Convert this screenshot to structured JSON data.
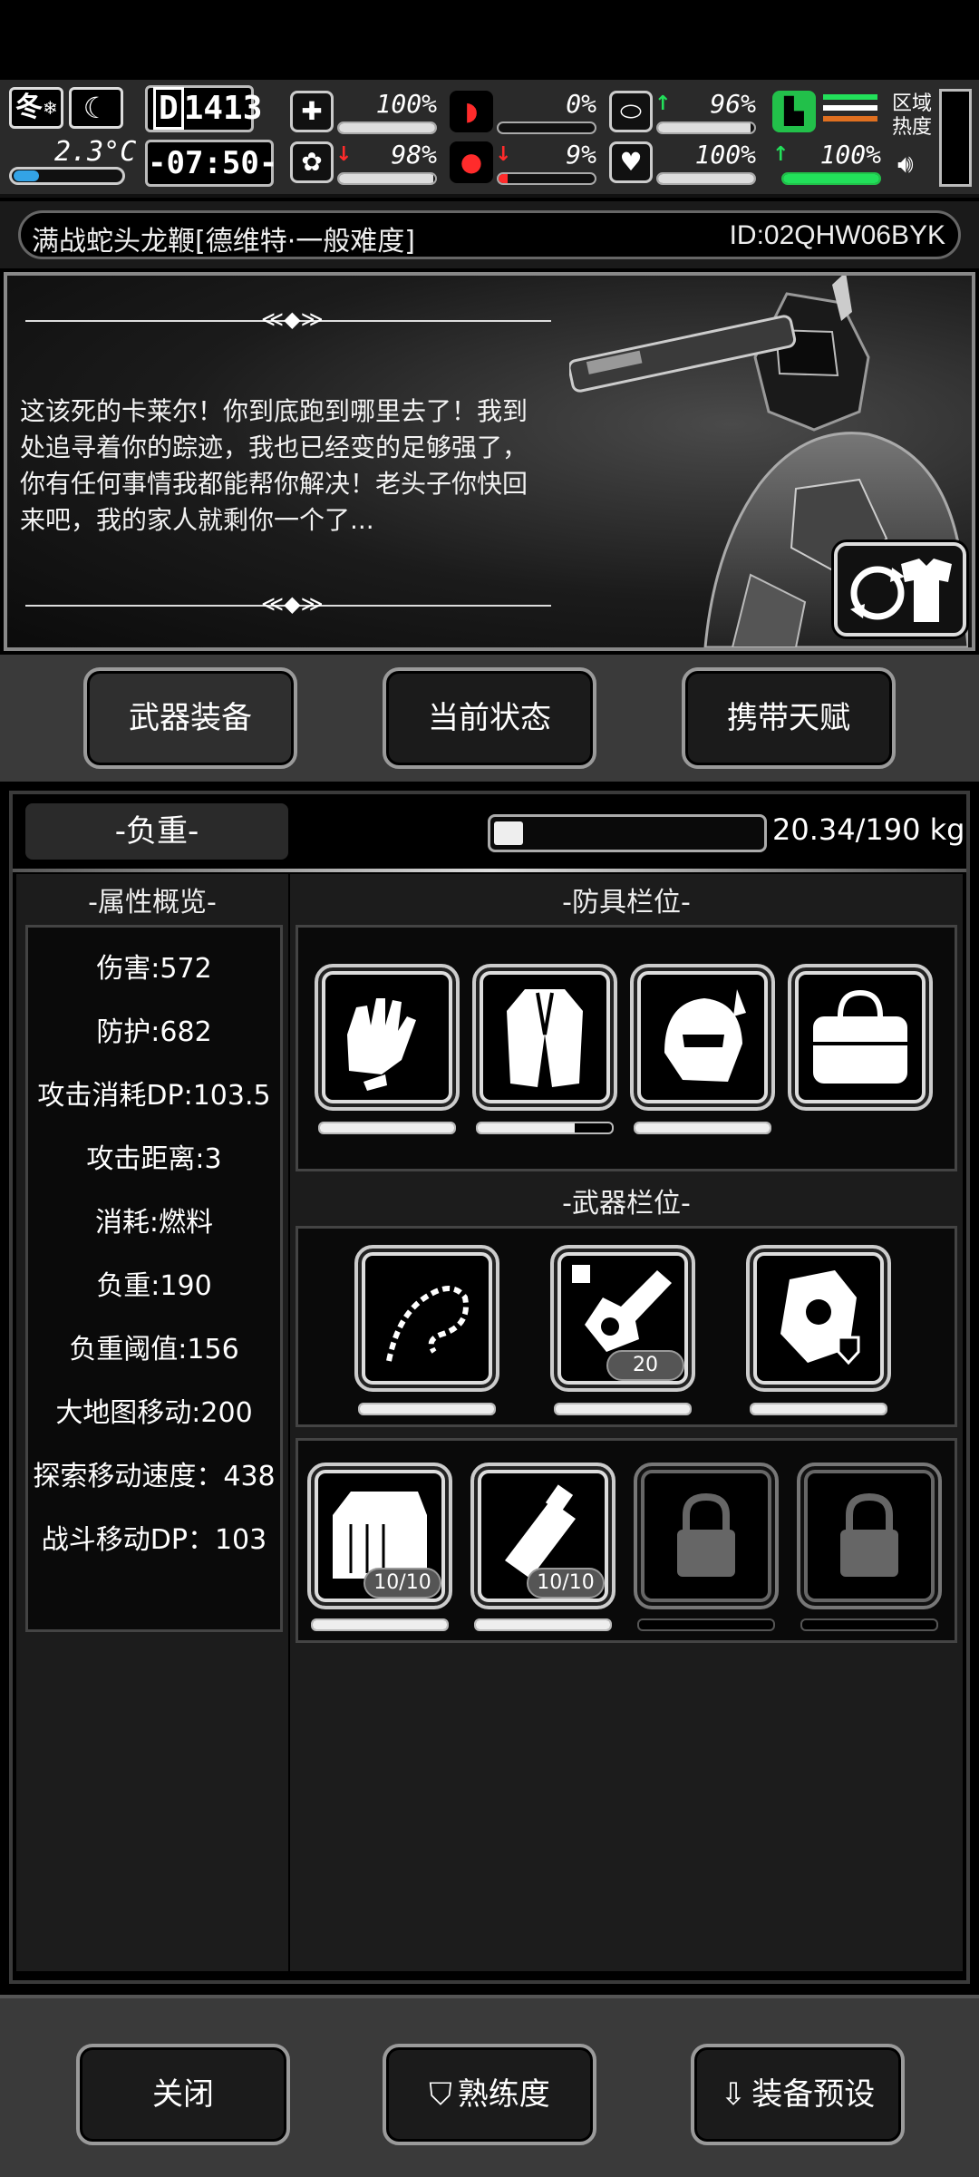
{
  "status": {
    "season": "冬",
    "temperature": "2.3°C",
    "day": "1413",
    "time": "-07:50-",
    "stats": [
      {
        "name": "health-kit",
        "icon": "medkit-icon",
        "value": "100%",
        "level": 1.0,
        "arrow": ""
      },
      {
        "name": "hunger",
        "icon": "stomach-icon",
        "value": "0%",
        "level": 0.0,
        "arrow": ""
      },
      {
        "name": "hydration",
        "icon": "capsule-icon",
        "value": "96%",
        "level": 0.96,
        "arrow": "up"
      },
      {
        "name": "mind",
        "icon": "brain-icon",
        "value": "98%",
        "level": 0.98,
        "arrow": "down"
      },
      {
        "name": "bleeding",
        "icon": "blood-drop-icon",
        "value": "9%",
        "level": 0.09,
        "arrow": "down"
      },
      {
        "name": "heart",
        "icon": "heart-icon",
        "value": "100%",
        "level": 1.0,
        "arrow": ""
      },
      {
        "name": "stamina",
        "icon": "boot-icon",
        "value": "100%",
        "level": 1.0,
        "arrow": "up"
      }
    ],
    "zone_label": "区域热度"
  },
  "title": {
    "map_name": "满战蛇头龙鞭[德维特·一般难度]",
    "id": "ID:02QHW06BYK"
  },
  "story": {
    "text": "这该死的卡莱尔！你到底跑到哪里去了！我到处追寻着你的踪迹，我也已经变的足够强了，你有任何事情我都能帮你解决！老头子你快回来吧，我的家人就剩你一个了..."
  },
  "tabs": [
    {
      "label": "武器装备",
      "active": true
    },
    {
      "label": "当前状态",
      "active": false
    },
    {
      "label": "携带天赋",
      "active": false
    }
  ],
  "load": {
    "label": "-负重-",
    "text": "20.34/190 kg",
    "fraction": 0.107
  },
  "attributes": {
    "header": "-属性概览-",
    "items": [
      "伤害:572",
      "防护:682",
      "攻击消耗DP:103.5",
      "攻击距离:3",
      "消耗:燃料",
      "负重:190",
      "负重阈值:156",
      "大地图移动:200",
      "探索移动速度：438",
      "战斗移动DP：103"
    ]
  },
  "armor": {
    "header": "-防具栏位-",
    "slots": [
      {
        "icon": "gloves-icon",
        "durability": 1.0
      },
      {
        "icon": "coat-icon",
        "durability": 0.72
      },
      {
        "icon": "helmet-icon",
        "durability": 1.0
      },
      {
        "icon": "bag-icon",
        "durability": null
      }
    ]
  },
  "weapons": {
    "header": "-武器栏位-",
    "slots": [
      {
        "icon": "whip-icon",
        "durability": 1.0,
        "count": ""
      },
      {
        "icon": "chainsaw-icon",
        "durability": 1.0,
        "count": "20"
      },
      {
        "icon": "shield-arm-icon",
        "durability": 1.0,
        "count": ""
      }
    ]
  },
  "items": {
    "slots": [
      {
        "icon": "crate-icon",
        "count": "10/10",
        "locked": false
      },
      {
        "icon": "fuel-can-icon",
        "count": "10/10",
        "locked": false
      },
      {
        "icon": "lock-icon",
        "count": "",
        "locked": true
      },
      {
        "icon": "lock-icon",
        "count": "",
        "locked": true
      }
    ]
  },
  "bottom": {
    "close": "关闭",
    "proficiency": "熟练度",
    "preset": "装备预设"
  },
  "colors": {
    "accent_up": "#22e05a",
    "accent_down": "#ff2b2b",
    "temperature_bar": "#33a3e6"
  }
}
